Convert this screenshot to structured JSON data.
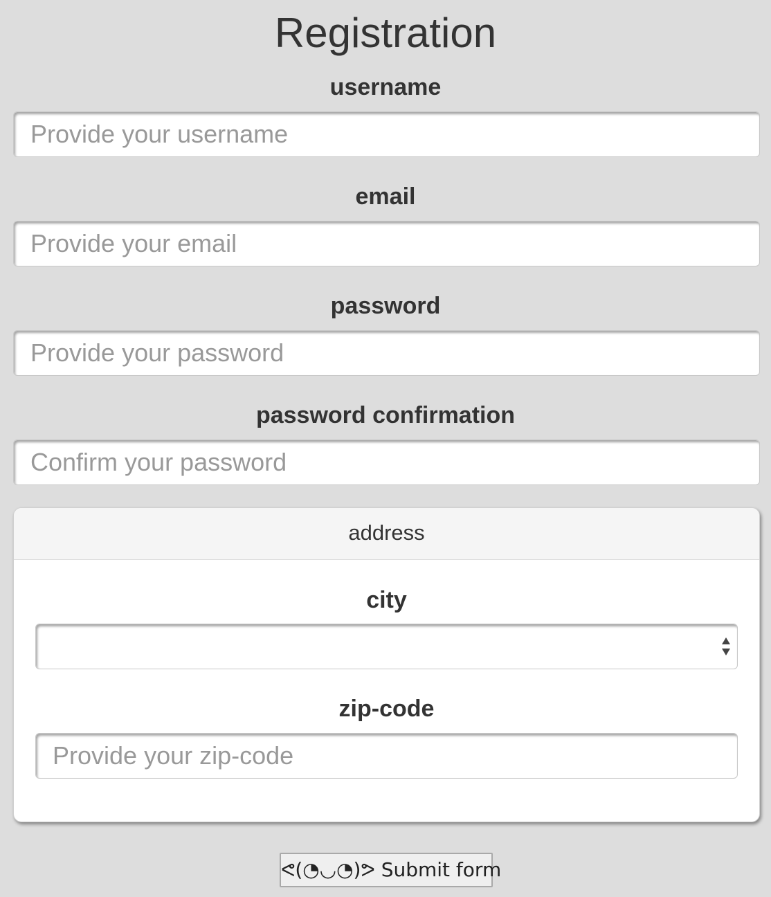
{
  "form": {
    "title": "Registration",
    "fields": {
      "username": {
        "label": "username",
        "placeholder": "Provide your username",
        "value": ""
      },
      "email": {
        "label": "email",
        "placeholder": "Provide your email",
        "value": ""
      },
      "password": {
        "label": "password",
        "placeholder": "Provide your password",
        "value": ""
      },
      "password_confirmation": {
        "label": "password confirmation",
        "placeholder": "Confirm your password",
        "value": ""
      }
    },
    "address": {
      "heading": "address",
      "city": {
        "label": "city",
        "selected": ""
      },
      "zip_code": {
        "label": "zip-code",
        "placeholder": "Provide your zip-code",
        "value": ""
      }
    },
    "submit_label": "ᕙ(◔◡◔)ᕗ Submit form"
  },
  "icons": {
    "select_arrows": "up-down-arrows-icon"
  }
}
